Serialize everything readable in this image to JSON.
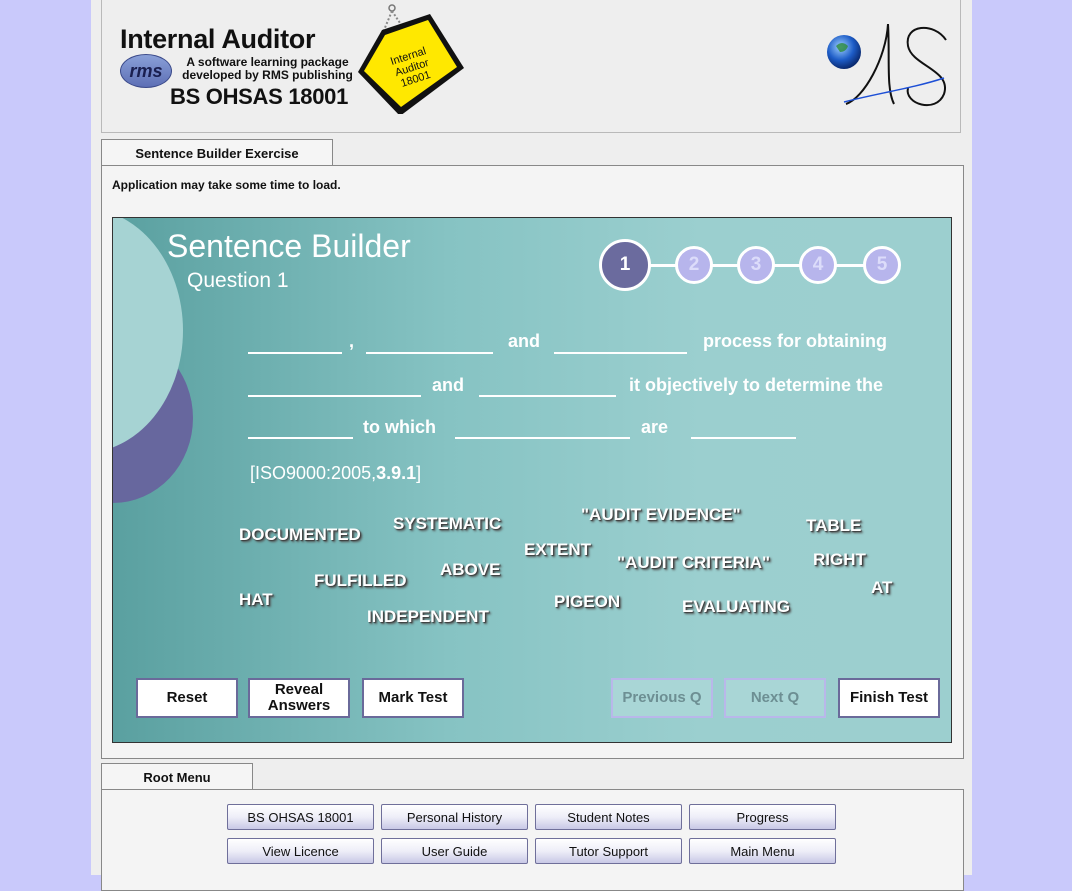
{
  "header": {
    "title": "Internal Auditor",
    "rms": "rms",
    "subtitle_line1": "A software learning package",
    "subtitle_line2": "developed by RMS publishing",
    "standard": "BS OHSAS 18001",
    "tag_line1": "Internal",
    "tag_line2": "Auditor",
    "tag_line3": "18001"
  },
  "exercise_tab": {
    "label": "Sentence Builder Exercise"
  },
  "loading_note": "Application may take some time to load.",
  "builder": {
    "title": "Sentence Builder",
    "question": "Question 1",
    "steps": [
      "1",
      "2",
      "3",
      "4",
      "5"
    ],
    "active_step": 1,
    "sentence": {
      "comma": ",",
      "and1": "and",
      "process_for_obtaining": "process for obtaining",
      "and2": "and",
      "objectively": "it objectively to determine the",
      "to_which": "to which",
      "are": "are"
    },
    "reference_prefix": "[ISO9000:2005,",
    "reference_bold": "3.9.1",
    "reference_suffix": "]",
    "words": [
      "DOCUMENTED",
      "SYSTEMATIC",
      "\"AUDIT EVIDENCE\"",
      "TABLE",
      "EXTENT",
      "\"AUDIT CRITERIA\"",
      "RIGHT",
      "ABOVE",
      "FULFILLED",
      "HAT",
      "AT",
      "PIGEON",
      "EVALUATING",
      "INDEPENDENT"
    ],
    "buttons": {
      "reset": "Reset",
      "reveal_line1": "Reveal",
      "reveal_line2": "Answers",
      "mark_test": "Mark Test",
      "previous": "Previous Q",
      "next": "Next Q",
      "finish": "Finish Test"
    }
  },
  "root_menu": {
    "label": "Root Menu",
    "row1": [
      "BS OHSAS 18001",
      "Personal History",
      "Student Notes",
      "Progress"
    ],
    "row2": [
      "View Licence",
      "User Guide",
      "Tutor Support",
      "Main Menu"
    ]
  },
  "colors": {
    "background": "#c9c9fb",
    "stage_teal": "#9bcfcf",
    "step_active": "#6b6b9e",
    "step_inactive": "#b7b5ec",
    "tag_yellow": "#ffe800"
  }
}
